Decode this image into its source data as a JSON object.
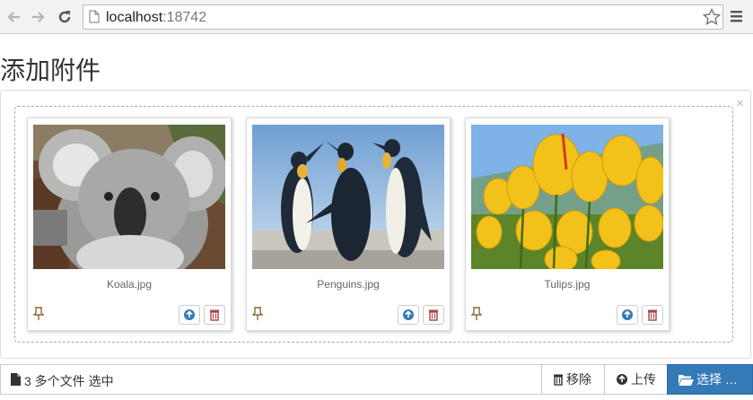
{
  "browser": {
    "url_host": "localhost",
    "url_port": ":18742",
    "icons": [
      "back-arrow-icon",
      "forward-arrow-icon",
      "reload-icon",
      "page-icon",
      "star-icon",
      "menu-icon"
    ]
  },
  "page": {
    "title": "添加附件"
  },
  "files": [
    {
      "name": "Koala.jpg"
    },
    {
      "name": "Penguins.jpg"
    },
    {
      "name": "Tulips.jpg"
    }
  ],
  "caption": {
    "text": "3 多个文件 选中"
  },
  "buttons": {
    "remove": "移除",
    "upload": "上传",
    "browse": "选择 …"
  },
  "colors": {
    "primary": "#337ab7",
    "upload_icon": "#337ab7",
    "delete_icon": "#a94442",
    "drag_icon": "#8a6d3b"
  }
}
